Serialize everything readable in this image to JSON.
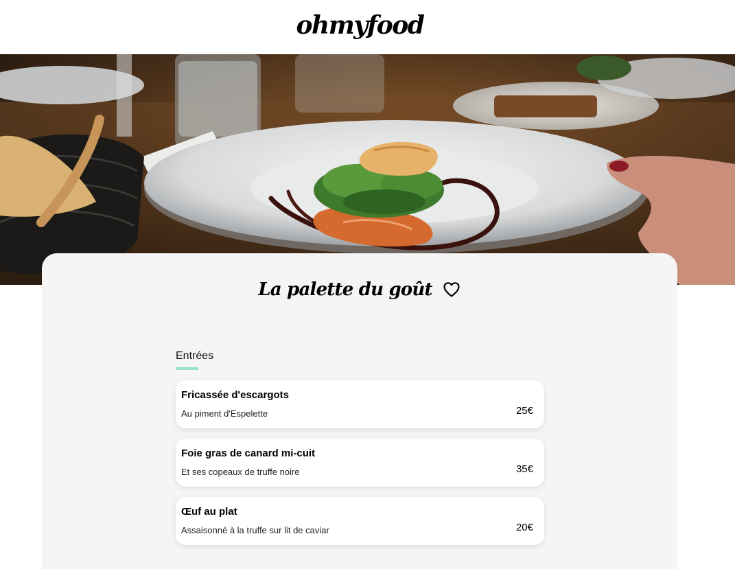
{
  "header": {
    "logo_text": "ohmyfood"
  },
  "hero": {
    "image_subject": "plated dish with salmon, greens and sauce on a restaurant table",
    "icon": "food-photo"
  },
  "restaurant": {
    "name": "La palette du goût",
    "favorite_icon": "heart-outline-icon"
  },
  "menu": {
    "sections": [
      {
        "title": "Entrées",
        "accent_color": "#99e2d0",
        "dishes": [
          {
            "name": "Fricassée d'escargots",
            "description": "Au piment d'Espelette",
            "price": "25€"
          },
          {
            "name": "Foie gras de canard mi-cuit",
            "description": "Et ses copeaux de truffe noire",
            "price": "35€"
          },
          {
            "name": "Œuf au plat",
            "description": "Assaisonné à la truffe sur lit de caviar",
            "price": "20€"
          }
        ]
      }
    ]
  },
  "colors": {
    "background": "#ffffff",
    "card": "#f5f5f5",
    "accent": "#99e2d0"
  }
}
